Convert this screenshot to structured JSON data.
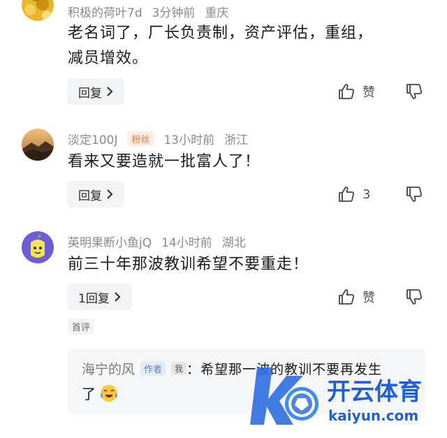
{
  "comments": [
    {
      "username": "积极的荷叶7d",
      "time": "3分钟前",
      "location": "重庆",
      "content_line1": "老名词了，厂长负责制，资产评估，重组，",
      "content_line2": "减员增效。",
      "reply_label": "回复",
      "like_label": "赞"
    },
    {
      "username": "淡定100J",
      "badge": "粉丝",
      "time": "13小时前",
      "location": "浙江",
      "content": "看来又要造就一批富人了！",
      "reply_label": "回复",
      "like_count": "3"
    },
    {
      "username": "英明果断小鱼jQ",
      "time": "14小时前",
      "location": "湖北",
      "content": "前三十年那波教训希望不要重走！",
      "reply_label": "1回复",
      "like_label": "赞",
      "first_tag": "首评",
      "subreply": {
        "author": "海宁的风",
        "author_badge": "作者",
        "me_badge": "我",
        "colon": "：",
        "text_line1": "希望那一波的教训不要再发生",
        "text_line2": "了"
      }
    }
  ],
  "watermark": {
    "brand_cn": "开云体育",
    "brand_en": "kaiyun.com"
  },
  "colors": {
    "accent_blue": "#2f6fe0",
    "fan_orange": "#e7782f",
    "author_blue": "#5b7fb6"
  }
}
